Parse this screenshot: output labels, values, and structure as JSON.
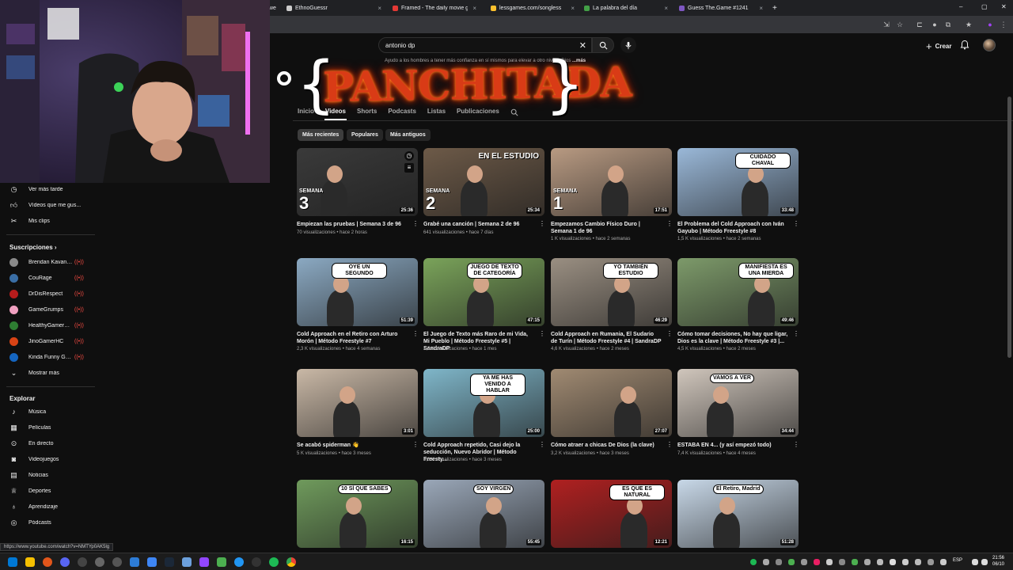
{
  "browser": {
    "tabs": [
      {
        "label": "owe",
        "color": "#888888"
      },
      {
        "label": "EthnoGuessr",
        "color": "#cccccc"
      },
      {
        "label": "Framed - The daily movie gues",
        "color": "#e53935"
      },
      {
        "label": "lessgames.com/songless",
        "color": "#fbc02d"
      },
      {
        "label": "La palabra del día",
        "color": "#43a047"
      },
      {
        "label": "Guess The.Game #1241",
        "color": "#7e57c2"
      }
    ],
    "new_tab": "+",
    "close_glyph": "×",
    "window_controls": [
      "–",
      "▢",
      "✕"
    ],
    "status_url": "https://www.youtube.com/watch?v=NMTYp0AK5lg"
  },
  "header": {
    "search_value": "antonio dp",
    "clear_glyph": "✕",
    "create_label": "Crear"
  },
  "channel": {
    "description": "Ayudo a los hombres a tener más confianza en sí mismos para elevar a otro nivel a Dios",
    "more_label": "...más",
    "banner_word": "PANCHITADA",
    "tabs": [
      "Inicio",
      "Videos",
      "Shorts",
      "Podcasts",
      "Listas",
      "Publicaciones"
    ],
    "active_tab": "Videos"
  },
  "sort_chips": [
    "Más recientes",
    "Populares",
    "Más antiguos"
  ],
  "sidebar": {
    "you_items": [
      {
        "label": "Ver más tarde",
        "icon": "clock-icon"
      },
      {
        "label": "Vídeos que me gus...",
        "icon": "thumb-up-icon"
      },
      {
        "label": "Mis clips",
        "icon": "scissors-icon"
      }
    ],
    "subs_heading": "Suscripciones",
    "subs_chevron": "›",
    "subscriptions": [
      {
        "label": "Brendan Kavana...",
        "color": "#8a8a8a"
      },
      {
        "label": "CouRage",
        "color": "#3a6ea5"
      },
      {
        "label": "DrDisRespect",
        "color": "#b71c1c"
      },
      {
        "label": "GameGrumps",
        "color": "#f0a0c0"
      },
      {
        "label": "HealthyGamerGG",
        "color": "#2e7d32"
      },
      {
        "label": "JinoGamerHC",
        "color": "#d84315"
      },
      {
        "label": "Kinda Funny Ga...",
        "color": "#1565c0"
      }
    ],
    "live_glyph": "((•))",
    "show_more": "Mostrar más",
    "explore_heading": "Explorar",
    "explore_items": [
      {
        "label": "Música",
        "icon": "music-icon"
      },
      {
        "label": "Películas",
        "icon": "film-icon"
      },
      {
        "label": "En directo",
        "icon": "live-icon"
      },
      {
        "label": "Videojuegos",
        "icon": "gamepad-icon"
      },
      {
        "label": "Noticias",
        "icon": "news-icon"
      },
      {
        "label": "Deportes",
        "icon": "trophy-icon"
      },
      {
        "label": "Aprendizaje",
        "icon": "bulb-icon"
      },
      {
        "label": "Pódcasts",
        "icon": "podcast-icon"
      }
    ]
  },
  "videos": [
    {
      "title": "Empiezan las pruebas | Semana 3 de 96",
      "meta1": "70 visualizaciones • hace 2 horas",
      "duration": "25:36",
      "bg": "#3a3a3a",
      "sem_word": "SEMANA",
      "sem_num": "3"
    },
    {
      "title": "Grabé una canción | Semana 2 de 96",
      "meta1": "641 visualizaciones • hace 7 días",
      "duration": "25:34",
      "bg": "#6d5a48",
      "sem_word": "SEMANA",
      "sem_num": "2",
      "caption": "EN EL ESTUDIO"
    },
    {
      "title": "Empezamos Cambio Físico Duro | Semana 1 de 96",
      "meta1": "1 K visualizaciones • hace 2 semanas",
      "duration": "17:51",
      "bg": "#b89a82",
      "sem_word": "SEMANA",
      "sem_num": "1"
    },
    {
      "title": "El Problema del Cold Approach con Iván Gayubo | Método Freestyle #8",
      "meta1": "1,5 K visualizaciones • hace 2 semanas",
      "duration": "33:48",
      "bg": "#9ab8d8",
      "caption": "CUIDADO CHAVAL"
    },
    {
      "title": "Cold Approach en el Retiro con Arturo Morón | Método Freestyle #7",
      "meta1": "2,3 K visualizaciones • hace 4 semanas",
      "duration": "51:39",
      "bg": "#8ba9c2",
      "caption": "OYE UN SEGUNDO"
    },
    {
      "title": "El Juego de Texto más Raro de mi Vida, Mi Pueblo | Método Freestyle #5 | SandraDP",
      "meta1": "1,5 K visualizaciones • hace 1 mes",
      "duration": "47:15",
      "bg": "#7aa35a",
      "caption": "JUEGO DE TEXTO DE CATEGORÍA"
    },
    {
      "title": "Cold Approach en Rumania, El Sudario de Turín | Método Freestyle #4 | SandraDP",
      "meta1": "4,6 K visualizaciones • hace 2 meses",
      "duration": "46:29",
      "bg": "#9a8f82",
      "caption": "YO TAMBIÉN ESTUDIO"
    },
    {
      "title": "Cómo tomar decisiones, No hay que ligar, Dios es la clave | Método Freestyle #3 |...",
      "meta1": "4,5 K visualizaciones • hace 2 meses",
      "duration": "49:46",
      "bg": "#7d9a6a",
      "caption": "MANIFIESTA ES UNA MIERDA"
    },
    {
      "title": "Se acabó spiderman 👋",
      "meta1": "5 K visualizaciones • hace 3 meses",
      "duration": "3:01",
      "bg": "#c9b8a6"
    },
    {
      "title": "Cold Approach repetido, Casi dejo la seducción, Nuevo Abridor | Método Freesty...",
      "meta1": "6,6 K visualizaciones • hace 3 meses",
      "duration": "25:00",
      "bg": "#7fb6c9",
      "caption": "YA ME HAS VENIDO A HABLAR"
    },
    {
      "title": "Cómo atraer a chicas De Dios (la clave)",
      "meta1": "3,2 K visualizaciones • hace 3 meses",
      "duration": "27:07",
      "bg": "#a08a72"
    },
    {
      "title": "ESTABA EN 4... (y así empezó todo)",
      "meta1": "7,4 K visualizaciones • hace 4 meses",
      "duration": "34:44",
      "bg": "#d0c6bc",
      "caption": "VAMOS A VER"
    },
    {
      "title": "",
      "meta1": "",
      "duration": "16:15",
      "bg": "#6f9a5c",
      "caption": "10 SÍ QUE SABES"
    },
    {
      "title": "",
      "meta1": "",
      "duration": "55:45",
      "bg": "#9aa7b8",
      "caption": "SOY VIRGEN"
    },
    {
      "title": "",
      "meta1": "",
      "duration": "12:21",
      "bg": "#b02020",
      "caption": "ES QUE ES NATURAL"
    },
    {
      "title": "",
      "meta1": "",
      "duration": "51:28",
      "bg": "#c8d8e8",
      "caption": "El Retiro, Madrid"
    }
  ],
  "taskbar": {
    "lang": "ESP",
    "time": "21:56",
    "date": "06/10"
  }
}
